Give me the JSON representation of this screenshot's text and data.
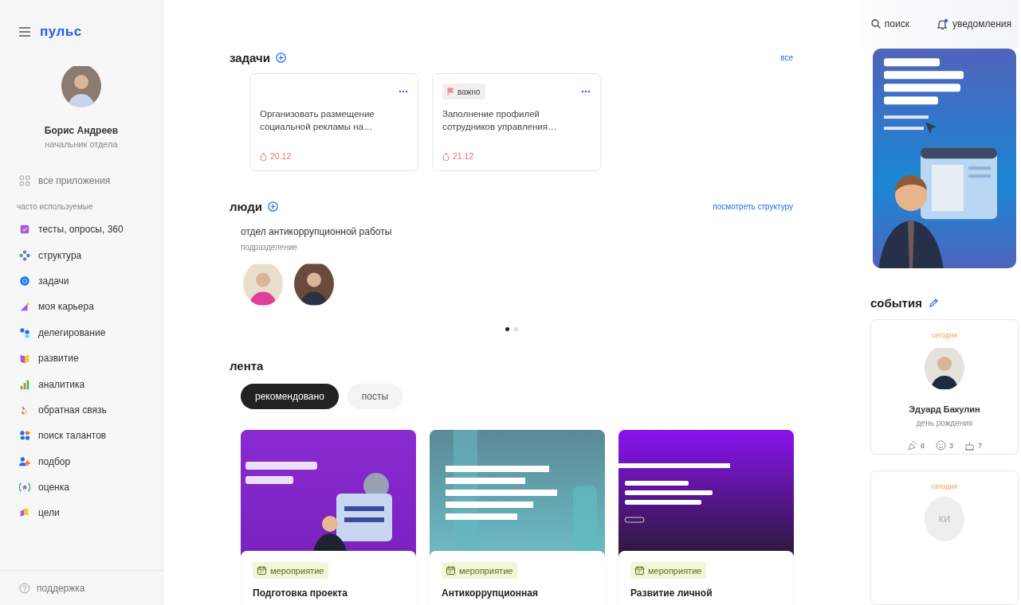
{
  "sidebar": {
    "logo": "пульс",
    "user": {
      "name": "Борис Андреев",
      "role": "начальник отдела"
    },
    "all_apps": "все приложения",
    "section_label": "часто используемые",
    "items": [
      {
        "label": "тесты, опросы, 360"
      },
      {
        "label": "структура"
      },
      {
        "label": "задачи"
      },
      {
        "label": "моя карьера"
      },
      {
        "label": "делегирование"
      },
      {
        "label": "развитие"
      },
      {
        "label": "аналитика"
      },
      {
        "label": "обратная связь"
      },
      {
        "label": "поиск талантов"
      },
      {
        "label": "подбор"
      },
      {
        "label": "оценка"
      },
      {
        "label": "цели"
      }
    ],
    "support": "поддержка"
  },
  "tasks": {
    "title": "задачи",
    "link": "все",
    "cards": [
      {
        "text": "Организовать размещение социальной рекламы на…",
        "due": "20.12"
      },
      {
        "tag": "важно",
        "text": "Заполнение профилей сотрудников управления…",
        "due": "21.12"
      }
    ]
  },
  "people": {
    "title": "люди",
    "link": "посмотреть структуру",
    "unit": "отдел антикоррупционной работы",
    "unit_label": "подразделение",
    "members": [
      {
        "kind": "avatar"
      },
      {
        "kind": "avatar"
      }
    ],
    "dots": [
      {
        "selected": true
      },
      {
        "selected": false
      }
    ]
  },
  "feed": {
    "title": "лента",
    "tabs": [
      {
        "label": "рекомендовано",
        "selected": true
      },
      {
        "label": "посты",
        "selected": false
      }
    ],
    "cards": [
      {
        "kind": "picture",
        "tag": "мероприятие",
        "title": "Подготовка проекта"
      },
      {
        "kind": "picture",
        "tag": "мероприятие",
        "title": "Антикоррупционная"
      },
      {
        "kind": "picture",
        "tag": "мероприятие",
        "title": "Развитие личной"
      }
    ]
  },
  "header": {
    "search": "поиск",
    "notifications": "уведомления",
    "has_unread": true
  },
  "events": {
    "title": "события",
    "cards": [
      {
        "day": "сегодня",
        "name": "Эдуард Бакулин",
        "occasion": "день рождения",
        "reactions": [
          {
            "count": "8"
          },
          {
            "count": "3"
          },
          {
            "count": "7"
          }
        ]
      },
      {
        "day": "сегодня",
        "initials": "КИ"
      }
    ]
  }
}
